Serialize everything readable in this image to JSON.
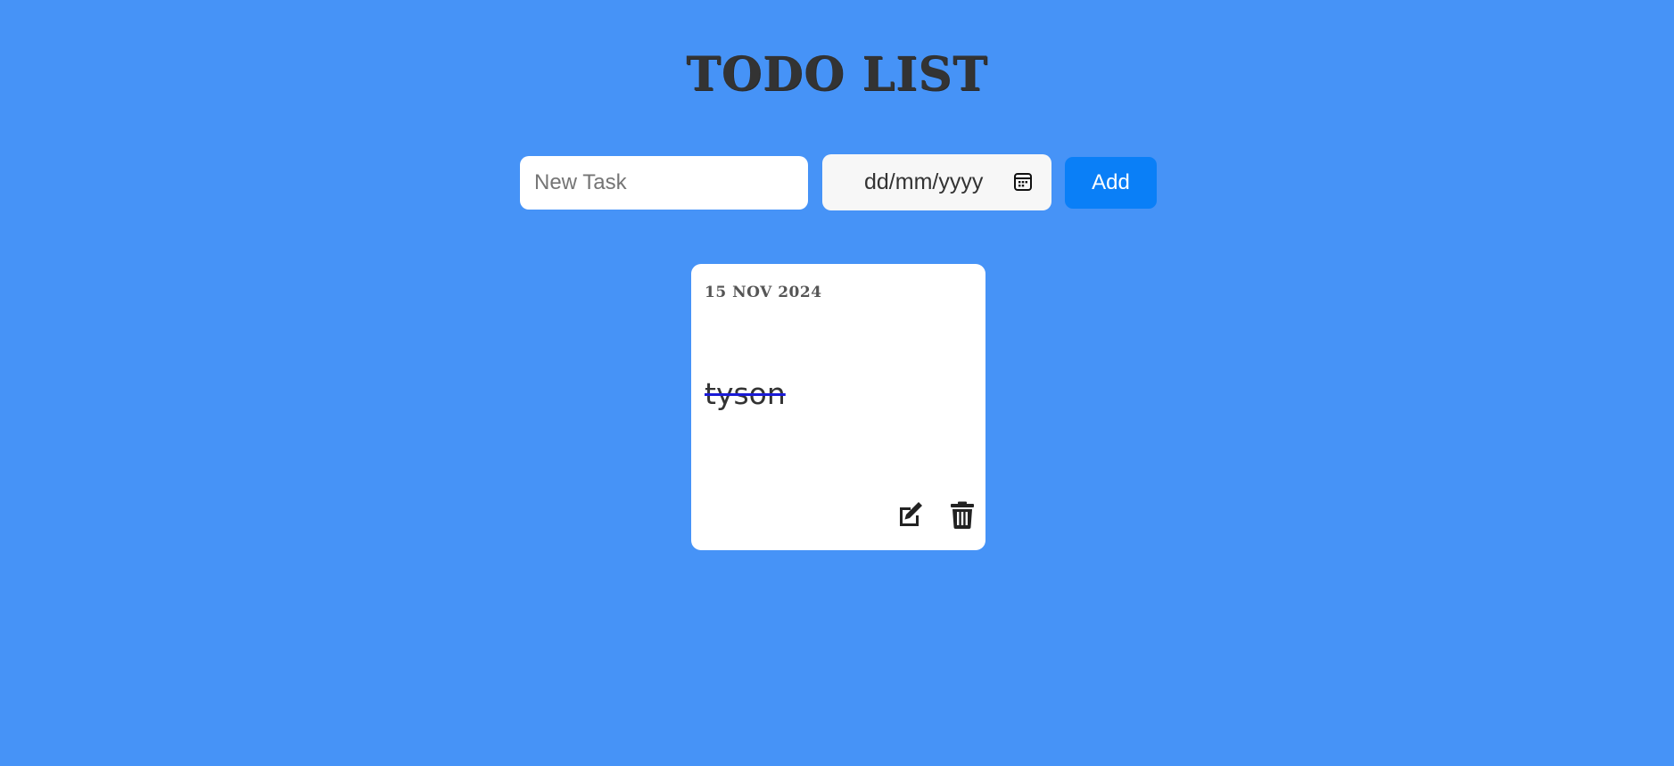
{
  "header": {
    "title": "TODO LIST"
  },
  "form": {
    "task_placeholder": "New Task",
    "date_placeholder": "dd/mm/yyyy",
    "add_label": "Add"
  },
  "tasks": [
    {
      "date": "15 NOV 2024",
      "text": "tyson",
      "completed": true
    }
  ],
  "colors": {
    "background": "#4693f7",
    "add_button": "#0a7ff7",
    "strike": "#1a1ad6"
  }
}
